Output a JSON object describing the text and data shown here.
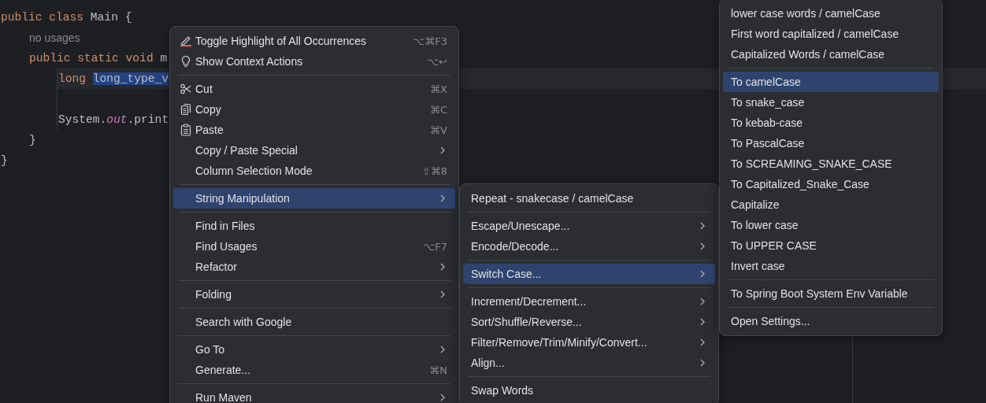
{
  "editor": {
    "lines": [
      {
        "kind": "code",
        "current": false,
        "tokens": [
          {
            "kind": "keyword",
            "text": "public class "
          },
          {
            "kind": "plain",
            "text": "Main {"
          }
        ],
        "children": [
          {
            "kind": "hint",
            "text": "no usages"
          },
          {
            "kind": "code",
            "current": false,
            "tokens": [
              {
                "kind": "keyword",
                "text": "public static void "
              },
              {
                "kind": "plain",
                "text": "m"
              }
            ],
            "children": [
              {
                "kind": "code",
                "current": true,
                "tokens": [
                  {
                    "kind": "keyword",
                    "text": "long "
                  },
                  {
                    "kind": "selection",
                    "text": "long_type_v"
                  }
                ]
              },
              {
                "kind": "blank"
              },
              {
                "kind": "code",
                "current": false,
                "tokens": [
                  {
                    "kind": "plain",
                    "text": "System."
                  },
                  {
                    "kind": "field",
                    "text": "out"
                  },
                  {
                    "kind": "plain",
                    "text": ".print"
                  }
                ]
              }
            ]
          },
          {
            "kind": "code",
            "current": false,
            "tokens": [
              {
                "kind": "plain",
                "text": "}"
              }
            ]
          }
        ]
      },
      {
        "kind": "code",
        "current": false,
        "tokens": [
          {
            "kind": "plain",
            "text": "}"
          }
        ]
      }
    ]
  },
  "menus": [
    {
      "items": [
        {
          "kind": "item",
          "label": "Toggle Highlight of All Occurrences",
          "shortcut": "⌥⌘F3",
          "submenu": false,
          "selected": false
        },
        {
          "kind": "item",
          "label": "Show Context Actions",
          "shortcut": "⌥↩",
          "submenu": false,
          "selected": false
        },
        {
          "kind": "separator"
        },
        {
          "kind": "item",
          "label": "Cut",
          "shortcut": "⌘X",
          "submenu": false,
          "selected": false
        },
        {
          "kind": "item",
          "label": "Copy",
          "shortcut": "⌘C",
          "submenu": false,
          "selected": false
        },
        {
          "kind": "item",
          "label": "Paste",
          "shortcut": "⌘V",
          "submenu": false,
          "selected": false
        },
        {
          "kind": "item",
          "label": "Copy / Paste Special",
          "submenu": true,
          "selected": false
        },
        {
          "kind": "item",
          "label": "Column Selection Mode",
          "shortcut": "⇧⌘8",
          "submenu": false,
          "selected": false
        },
        {
          "kind": "separator"
        },
        {
          "kind": "item",
          "label": "String Manipulation",
          "submenu": true,
          "selected": true
        },
        {
          "kind": "separator"
        },
        {
          "kind": "item",
          "label": "Find in Files",
          "submenu": false,
          "selected": false
        },
        {
          "kind": "item",
          "label": "Find Usages",
          "shortcut": "⌥F7",
          "submenu": false,
          "selected": false
        },
        {
          "kind": "item",
          "label": "Refactor",
          "submenu": true,
          "selected": false
        },
        {
          "kind": "separator"
        },
        {
          "kind": "item",
          "label": "Folding",
          "submenu": true,
          "selected": false
        },
        {
          "kind": "separator"
        },
        {
          "kind": "item",
          "label": "Search with Google",
          "submenu": false,
          "selected": false
        },
        {
          "kind": "separator"
        },
        {
          "kind": "item",
          "label": "Go To",
          "submenu": true,
          "selected": false
        },
        {
          "kind": "item",
          "label": "Generate...",
          "shortcut": "⌘N",
          "submenu": false,
          "selected": false
        },
        {
          "kind": "separator"
        },
        {
          "kind": "item",
          "label": "Run Maven",
          "submenu": true,
          "selected": false
        }
      ]
    },
    {
      "items": [
        {
          "kind": "item",
          "label": "Repeat - snakecase / camelCase",
          "submenu": false,
          "selected": false
        },
        {
          "kind": "separator"
        },
        {
          "kind": "item",
          "label": "Escape/Unescape...",
          "submenu": true,
          "selected": false
        },
        {
          "kind": "item",
          "label": "Encode/Decode...",
          "submenu": true,
          "selected": false
        },
        {
          "kind": "separator"
        },
        {
          "kind": "item",
          "label": "Switch Case...",
          "submenu": true,
          "selected": true
        },
        {
          "kind": "separator"
        },
        {
          "kind": "item",
          "label": "Increment/Decrement...",
          "submenu": true,
          "selected": false
        },
        {
          "kind": "item",
          "label": "Sort/Shuffle/Reverse...",
          "submenu": true,
          "selected": false
        },
        {
          "kind": "item",
          "label": "Filter/Remove/Trim/Minify/Convert...",
          "submenu": true,
          "selected": false
        },
        {
          "kind": "item",
          "label": "Align...",
          "submenu": true,
          "selected": false
        },
        {
          "kind": "separator"
        },
        {
          "kind": "item",
          "label": "Swap Words",
          "submenu": false,
          "selected": false
        }
      ]
    },
    {
      "items": [
        {
          "kind": "item",
          "label": "lower case words / camelCase",
          "submenu": false,
          "selected": false
        },
        {
          "kind": "item",
          "label": "First word capitalized / camelCase",
          "submenu": false,
          "selected": false
        },
        {
          "kind": "item",
          "label": "Capitalized Words / camelCase",
          "submenu": false,
          "selected": false
        },
        {
          "kind": "separator"
        },
        {
          "kind": "item",
          "label": "To camelCase",
          "submenu": false,
          "selected": true
        },
        {
          "kind": "item",
          "label": "To snake_case",
          "submenu": false,
          "selected": false
        },
        {
          "kind": "item",
          "label": "To kebab-case",
          "submenu": false,
          "selected": false
        },
        {
          "kind": "item",
          "label": "To PascalCase",
          "submenu": false,
          "selected": false
        },
        {
          "kind": "item",
          "label": "To SCREAMING_SNAKE_CASE",
          "submenu": false,
          "selected": false
        },
        {
          "kind": "item",
          "label": "To Capitalized_Snake_Case",
          "submenu": false,
          "selected": false
        },
        {
          "kind": "item",
          "label": "Capitalize",
          "submenu": false,
          "selected": false
        },
        {
          "kind": "item",
          "label": "To lower case",
          "submenu": false,
          "selected": false
        },
        {
          "kind": "item",
          "label": "To UPPER CASE",
          "submenu": false,
          "selected": false
        },
        {
          "kind": "item",
          "label": "Invert case",
          "submenu": false,
          "selected": false
        },
        {
          "kind": "separator"
        },
        {
          "kind": "item",
          "label": "To Spring Boot System Env Variable",
          "submenu": false,
          "selected": false
        },
        {
          "kind": "separator"
        },
        {
          "kind": "item",
          "label": "Open Settings...",
          "submenu": false,
          "selected": false
        }
      ]
    }
  ]
}
